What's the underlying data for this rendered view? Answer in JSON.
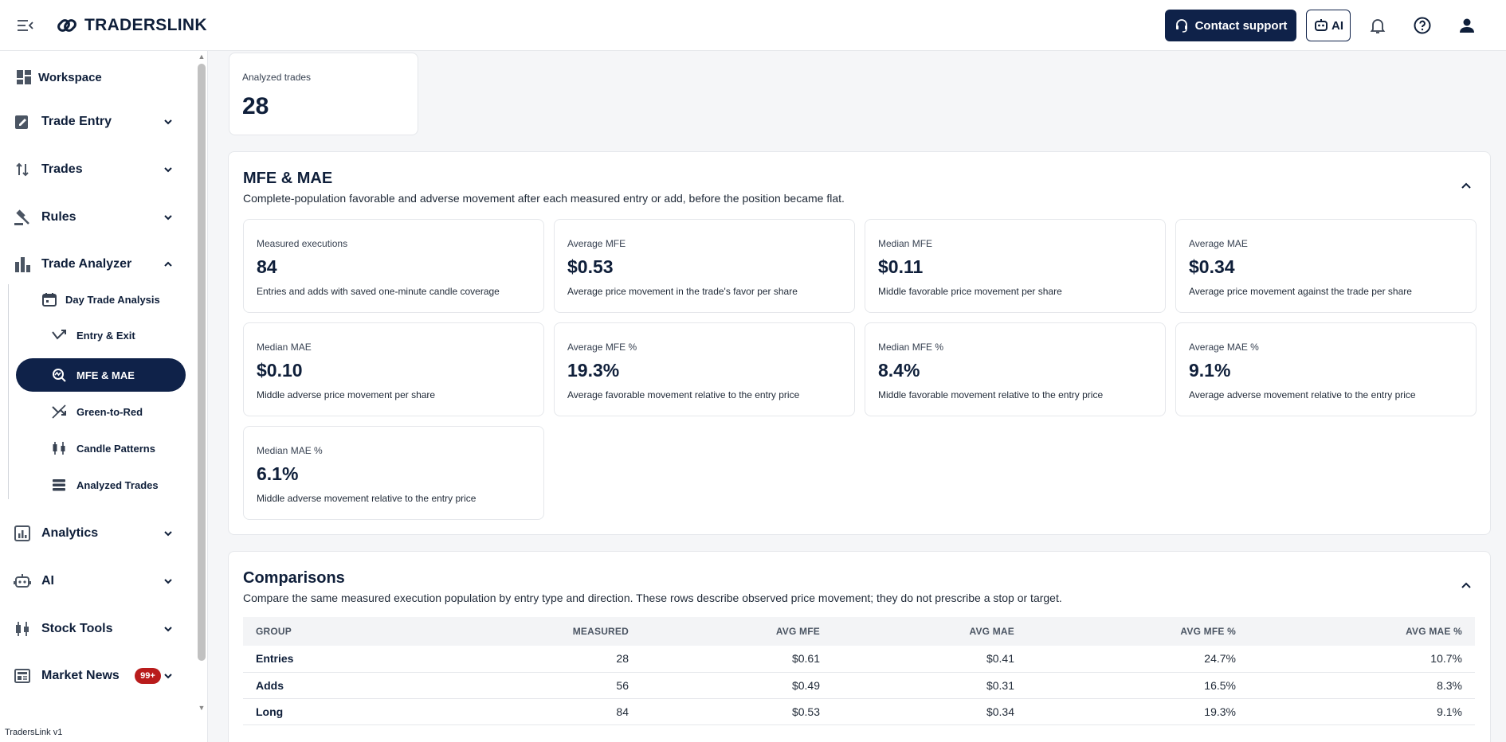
{
  "header": {
    "brand": "TRADERSLINK",
    "contact_label": "Contact support",
    "ai_label": "AI"
  },
  "sidebar": {
    "items": [
      {
        "label": "Workspace",
        "icon": "dashboard-icon"
      },
      {
        "label": "Trade Entry",
        "icon": "edit-note-icon"
      },
      {
        "label": "Trades",
        "icon": "swap-vertical-icon"
      },
      {
        "label": "Rules",
        "icon": "gavel-icon"
      },
      {
        "label": "Trade Analyzer",
        "icon": "bar-chart-icon"
      },
      {
        "label": "Analytics",
        "icon": "analytics-icon"
      },
      {
        "label": "AI",
        "icon": "robot-icon"
      },
      {
        "label": "Stock Tools",
        "icon": "candlestick-icon"
      },
      {
        "label": "Market News",
        "icon": "newspaper-icon",
        "badge": "99+"
      }
    ],
    "subitems": [
      {
        "label": "Day Trade Analysis",
        "icon": "calendar-icon"
      },
      {
        "label": "Entry & Exit",
        "icon": "merge-arrow-icon"
      },
      {
        "label": "MFE & MAE",
        "icon": "query-stats-icon",
        "active": true
      },
      {
        "label": "Green-to-Red",
        "icon": "trending-down-icon"
      },
      {
        "label": "Candle Patterns",
        "icon": "candlestick-icon"
      },
      {
        "label": "Analyzed Trades",
        "icon": "list-icon"
      }
    ],
    "version": "TradersLink v1"
  },
  "summary": {
    "label": "Analyzed trades",
    "value": "28"
  },
  "mfe_mae": {
    "title": "MFE & MAE",
    "description": "Complete-population favorable and adverse movement after each measured entry or add, before the position became flat.",
    "metrics": [
      {
        "label": "Measured executions",
        "value": "84",
        "desc": "Entries and adds with saved one-minute candle coverage"
      },
      {
        "label": "Average MFE",
        "value": "$0.53",
        "desc": "Average price movement in the trade's favor per share"
      },
      {
        "label": "Median MFE",
        "value": "$0.11",
        "desc": "Middle favorable price movement per share"
      },
      {
        "label": "Average MAE",
        "value": "$0.34",
        "desc": "Average price movement against the trade per share"
      },
      {
        "label": "Median MAE",
        "value": "$0.10",
        "desc": "Middle adverse price movement per share"
      },
      {
        "label": "Average MFE %",
        "value": "19.3%",
        "desc": "Average favorable movement relative to the entry price"
      },
      {
        "label": "Median MFE %",
        "value": "8.4%",
        "desc": "Middle favorable movement relative to the entry price"
      },
      {
        "label": "Average MAE %",
        "value": "9.1%",
        "desc": "Average adverse movement relative to the entry price"
      },
      {
        "label": "Median MAE %",
        "value": "6.1%",
        "desc": "Middle adverse movement relative to the entry price"
      }
    ]
  },
  "comparisons": {
    "title": "Comparisons",
    "description": "Compare the same measured execution population by entry type and direction. These rows describe observed price movement; they do not prescribe a stop or target.",
    "columns": [
      "GROUP",
      "MEASURED",
      "AVG MFE",
      "AVG MAE",
      "AVG MFE %",
      "AVG MAE %"
    ],
    "rows": [
      [
        "Entries",
        "28",
        "$0.61",
        "$0.41",
        "24.7%",
        "10.7%"
      ],
      [
        "Adds",
        "56",
        "$0.49",
        "$0.31",
        "16.5%",
        "8.3%"
      ],
      [
        "Long",
        "84",
        "$0.53",
        "$0.34",
        "19.3%",
        "9.1%"
      ]
    ]
  }
}
